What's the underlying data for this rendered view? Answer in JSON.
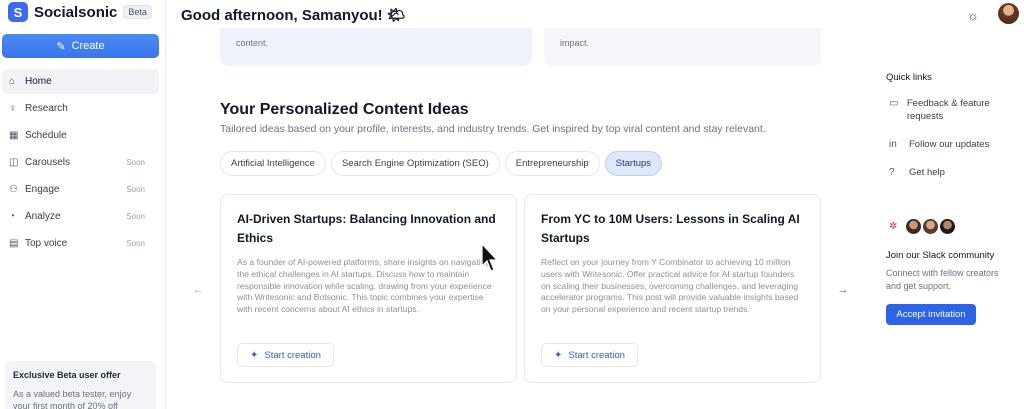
{
  "brand": {
    "name": "Socialsonic",
    "badge": "Beta",
    "logo_icon": "S"
  },
  "sidebar": {
    "create_label": "Create",
    "items": [
      {
        "label": "Home",
        "icon": "home-icon",
        "glyph": "⌂",
        "soon": ""
      },
      {
        "label": "Research",
        "icon": "bulb-icon",
        "glyph": "♀",
        "soon": ""
      },
      {
        "label": "Schedule",
        "icon": "calendar-icon",
        "glyph": "▦",
        "soon": ""
      },
      {
        "label": "Carousels",
        "icon": "carousel-icon",
        "glyph": "◫",
        "soon": "Soon"
      },
      {
        "label": "Engage",
        "icon": "users-icon",
        "glyph": "⚇",
        "soon": "Soon"
      },
      {
        "label": "Analyze",
        "icon": "chart-pie-icon",
        "glyph": "◔",
        "soon": "Soon"
      },
      {
        "label": "Top voice",
        "icon": "id-card-icon",
        "glyph": "▤",
        "soon": "Soon"
      }
    ],
    "beta_offer": {
      "title": "Exclusive Beta user offer",
      "desc": "As a valued beta tester, enjoy your first month of 20% off"
    }
  },
  "header": {
    "greeting": "Good afternoon, Samanyou! 🌤"
  },
  "top_cards": [
    {
      "text": "content."
    },
    {
      "text": "impact."
    }
  ],
  "ideas": {
    "title": "Your Personalized Content Ideas",
    "subtitle": "Tailored ideas based on your profile, interests, and industry trends. Get inspired by top viral content and stay relevant.",
    "tabs": [
      {
        "label": "Artificial Intelligence"
      },
      {
        "label": "Search Engine Optimization (SEO)"
      },
      {
        "label": "Entrepreneurship"
      },
      {
        "label": "Startups"
      }
    ],
    "active_tab": "Startups",
    "cards": [
      {
        "title": "AI-Driven Startups: Balancing Innovation and Ethics",
        "desc": "As a founder of AI-powered platforms, share insights on navigating the ethical challenges in AI startups. Discuss how to maintain responsible innovation while scaling, drawing from your experience with Writesonic and Botsonic. This topic combines your expertise with recent concerns about AI ethics in startups.",
        "button": "Start creation"
      },
      {
        "title": "From YC to 10M Users: Lessons in Scaling AI Startups",
        "desc": "Reflect on your journey from Y Combinator to achieving 10 million users with Writesonic. Offer practical advice for AI startup founders on scaling their businesses, overcoming challenges, and leveraging accelerator programs. This post will provide valuable insights based on your personal experience and recent startup trends.",
        "button": "Start creation"
      }
    ]
  },
  "quick_links": {
    "title": "Quick links",
    "items": [
      {
        "label": "Feedback & feature requests",
        "icon": "feedback-icon",
        "glyph": "▭"
      },
      {
        "label": "Follow our updates",
        "icon": "linkedin-icon",
        "glyph": "in"
      },
      {
        "label": "Get help",
        "icon": "help-icon",
        "glyph": "?"
      }
    ]
  },
  "slack": {
    "title": "Join our Slack community",
    "desc": "Connect with fellow creators and get support.",
    "button": "Accept invitation"
  },
  "colors": {
    "accent": "#3b6cf0",
    "active_tab_bg": "#dfe8fb",
    "button_blue": "#2d63e6"
  }
}
